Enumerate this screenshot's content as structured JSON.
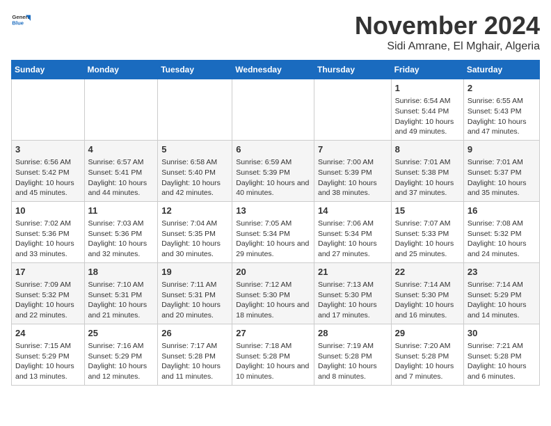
{
  "header": {
    "logo_general": "General",
    "logo_blue": "Blue",
    "month": "November 2024",
    "location": "Sidi Amrane, El Mghair, Algeria"
  },
  "days_of_week": [
    "Sunday",
    "Monday",
    "Tuesday",
    "Wednesday",
    "Thursday",
    "Friday",
    "Saturday"
  ],
  "weeks": [
    {
      "cells": [
        {
          "day": "",
          "text": ""
        },
        {
          "day": "",
          "text": ""
        },
        {
          "day": "",
          "text": ""
        },
        {
          "day": "",
          "text": ""
        },
        {
          "day": "",
          "text": ""
        },
        {
          "day": "1",
          "text": "Sunrise: 6:54 AM\nSunset: 5:44 PM\nDaylight: 10 hours and 49 minutes."
        },
        {
          "day": "2",
          "text": "Sunrise: 6:55 AM\nSunset: 5:43 PM\nDaylight: 10 hours and 47 minutes."
        }
      ]
    },
    {
      "cells": [
        {
          "day": "3",
          "text": "Sunrise: 6:56 AM\nSunset: 5:42 PM\nDaylight: 10 hours and 45 minutes."
        },
        {
          "day": "4",
          "text": "Sunrise: 6:57 AM\nSunset: 5:41 PM\nDaylight: 10 hours and 44 minutes."
        },
        {
          "day": "5",
          "text": "Sunrise: 6:58 AM\nSunset: 5:40 PM\nDaylight: 10 hours and 42 minutes."
        },
        {
          "day": "6",
          "text": "Sunrise: 6:59 AM\nSunset: 5:39 PM\nDaylight: 10 hours and 40 minutes."
        },
        {
          "day": "7",
          "text": "Sunrise: 7:00 AM\nSunset: 5:39 PM\nDaylight: 10 hours and 38 minutes."
        },
        {
          "day": "8",
          "text": "Sunrise: 7:01 AM\nSunset: 5:38 PM\nDaylight: 10 hours and 37 minutes."
        },
        {
          "day": "9",
          "text": "Sunrise: 7:01 AM\nSunset: 5:37 PM\nDaylight: 10 hours and 35 minutes."
        }
      ]
    },
    {
      "cells": [
        {
          "day": "10",
          "text": "Sunrise: 7:02 AM\nSunset: 5:36 PM\nDaylight: 10 hours and 33 minutes."
        },
        {
          "day": "11",
          "text": "Sunrise: 7:03 AM\nSunset: 5:36 PM\nDaylight: 10 hours and 32 minutes."
        },
        {
          "day": "12",
          "text": "Sunrise: 7:04 AM\nSunset: 5:35 PM\nDaylight: 10 hours and 30 minutes."
        },
        {
          "day": "13",
          "text": "Sunrise: 7:05 AM\nSunset: 5:34 PM\nDaylight: 10 hours and 29 minutes."
        },
        {
          "day": "14",
          "text": "Sunrise: 7:06 AM\nSunset: 5:34 PM\nDaylight: 10 hours and 27 minutes."
        },
        {
          "day": "15",
          "text": "Sunrise: 7:07 AM\nSunset: 5:33 PM\nDaylight: 10 hours and 25 minutes."
        },
        {
          "day": "16",
          "text": "Sunrise: 7:08 AM\nSunset: 5:32 PM\nDaylight: 10 hours and 24 minutes."
        }
      ]
    },
    {
      "cells": [
        {
          "day": "17",
          "text": "Sunrise: 7:09 AM\nSunset: 5:32 PM\nDaylight: 10 hours and 22 minutes."
        },
        {
          "day": "18",
          "text": "Sunrise: 7:10 AM\nSunset: 5:31 PM\nDaylight: 10 hours and 21 minutes."
        },
        {
          "day": "19",
          "text": "Sunrise: 7:11 AM\nSunset: 5:31 PM\nDaylight: 10 hours and 20 minutes."
        },
        {
          "day": "20",
          "text": "Sunrise: 7:12 AM\nSunset: 5:30 PM\nDaylight: 10 hours and 18 minutes."
        },
        {
          "day": "21",
          "text": "Sunrise: 7:13 AM\nSunset: 5:30 PM\nDaylight: 10 hours and 17 minutes."
        },
        {
          "day": "22",
          "text": "Sunrise: 7:14 AM\nSunset: 5:30 PM\nDaylight: 10 hours and 16 minutes."
        },
        {
          "day": "23",
          "text": "Sunrise: 7:14 AM\nSunset: 5:29 PM\nDaylight: 10 hours and 14 minutes."
        }
      ]
    },
    {
      "cells": [
        {
          "day": "24",
          "text": "Sunrise: 7:15 AM\nSunset: 5:29 PM\nDaylight: 10 hours and 13 minutes."
        },
        {
          "day": "25",
          "text": "Sunrise: 7:16 AM\nSunset: 5:29 PM\nDaylight: 10 hours and 12 minutes."
        },
        {
          "day": "26",
          "text": "Sunrise: 7:17 AM\nSunset: 5:28 PM\nDaylight: 10 hours and 11 minutes."
        },
        {
          "day": "27",
          "text": "Sunrise: 7:18 AM\nSunset: 5:28 PM\nDaylight: 10 hours and 10 minutes."
        },
        {
          "day": "28",
          "text": "Sunrise: 7:19 AM\nSunset: 5:28 PM\nDaylight: 10 hours and 8 minutes."
        },
        {
          "day": "29",
          "text": "Sunrise: 7:20 AM\nSunset: 5:28 PM\nDaylight: 10 hours and 7 minutes."
        },
        {
          "day": "30",
          "text": "Sunrise: 7:21 AM\nSunset: 5:28 PM\nDaylight: 10 hours and 6 minutes."
        }
      ]
    }
  ]
}
